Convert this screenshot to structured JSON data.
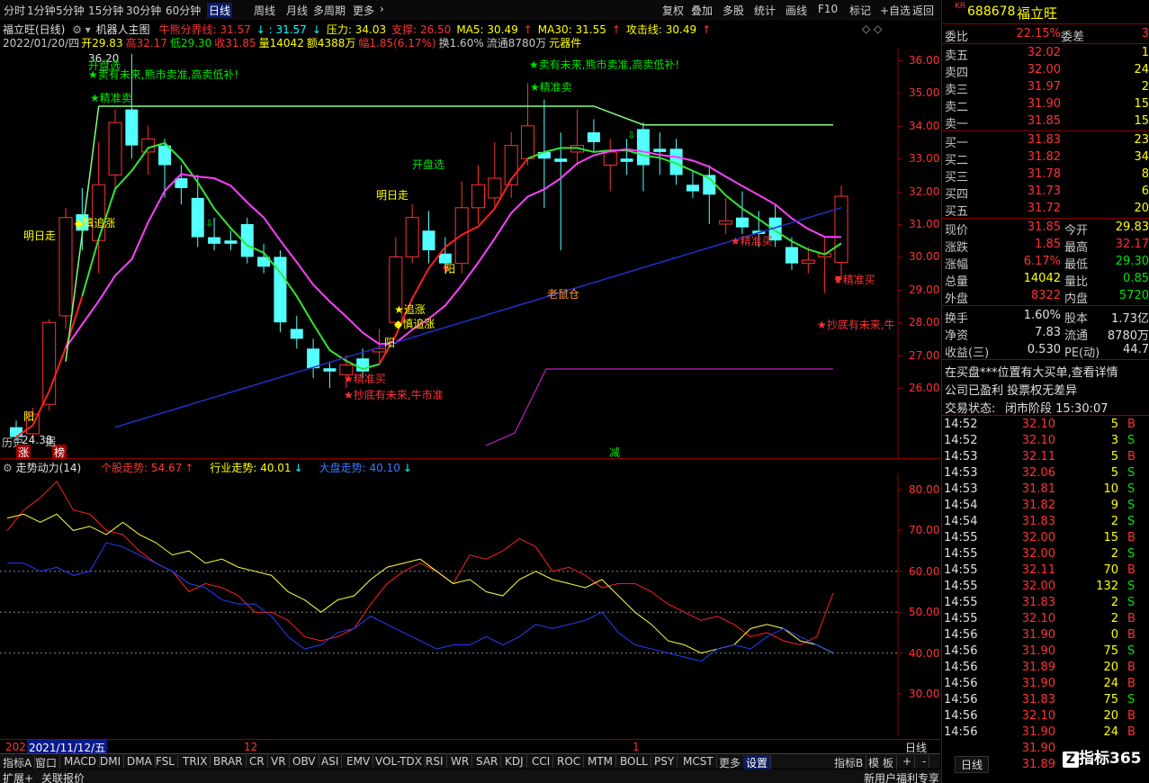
{
  "toolbar": {
    "left": [
      "分时",
      "1分钟",
      "5分钟",
      "15分钟",
      "30分钟",
      "60分钟",
      "日线",
      "周线",
      "月线",
      "多周期",
      "更多"
    ],
    "active": "日线",
    "right": [
      "复权",
      "叠加",
      "多股",
      "统计",
      "画线",
      "F10",
      "标记",
      "+自选",
      "返回"
    ]
  },
  "header": {
    "title": "福立旺(日线)",
    "indicator": "机器人主图",
    "ind_items": [
      {
        "t": "牛熊分界线: 31.57",
        "c": "#ff3232"
      },
      {
        "t": "↓ : 31.57",
        "c": "#00ffff"
      },
      {
        "t": "↓",
        "c": "#00ffff"
      },
      {
        "t": "压力: 34.03",
        "c": "#ffff00"
      },
      {
        "t": "支撑: 26.50",
        "c": "#ff3232"
      },
      {
        "t": "MA5: 30.49",
        "c": "#ffff00"
      },
      {
        "t": "↑",
        "c": "#ff3232"
      },
      {
        "t": "MA30: 31.55",
        "c": "#ffff00"
      },
      {
        "t": "↑",
        "c": "#ff3232"
      },
      {
        "t": "攻击线: 30.49",
        "c": "#ffff00"
      },
      {
        "t": "↑",
        "c": "#ff3232"
      }
    ],
    "quote": [
      {
        "t": "2022/01/20/四",
        "c": "#c8c8c8"
      },
      {
        "t": "开29.83",
        "c": "#ffff00"
      },
      {
        "t": "高32.17",
        "c": "#ff3232"
      },
      {
        "t": "低29.30",
        "c": "#00e600"
      },
      {
        "t": "收31.85",
        "c": "#ff3232"
      },
      {
        "t": "量14042",
        "c": "#ffff00"
      },
      {
        "t": "额4388万",
        "c": "#ffff00"
      },
      {
        "t": "幅1.85(6.17%)",
        "c": "#ff3232"
      },
      {
        "t": "换1.60%",
        "c": "#c8c8c8"
      },
      {
        "t": "流通8780万",
        "c": "#c8c8c8"
      },
      {
        "t": "元器件",
        "c": "#ffff00"
      }
    ]
  },
  "price_axis": [
    "36.00",
    "35.00",
    "34.00",
    "33.00",
    "32.00",
    "31.00",
    "30.00",
    "29.00",
    "28.00",
    "27.00",
    "26.00"
  ],
  "high_label": "36.20",
  "low_label": "24.38",
  "low_prefix": "历史",
  "annotations": [
    {
      "t": "开盘选",
      "c": "#00e600"
    },
    {
      "t": "★卖有未来,熊市卖准,高卖低补!",
      "c": "#00e600"
    },
    {
      "t": "★精准卖",
      "c": "#00e600"
    },
    {
      "t": "★卖有未来,熊市卖准,高卖低补!",
      "c": "#00e600"
    },
    {
      "t": "★精准卖",
      "c": "#00e600"
    },
    {
      "t": "开盘选",
      "c": "#00e600"
    },
    {
      "t": "明日走",
      "c": "#ffff00"
    },
    {
      "t": "明日走",
      "c": "#ffff00"
    },
    {
      "t": "◆慎追涨",
      "c": "#ffff00"
    },
    {
      "t": "★追涨",
      "c": "#ffff00"
    },
    {
      "t": "◆慎追涨",
      "c": "#ffff00"
    },
    {
      "t": "阳",
      "c": "#ffff00"
    },
    {
      "t": "阳",
      "c": "#ffff00"
    },
    {
      "t": "阳",
      "c": "#ffff00"
    },
    {
      "t": "★精准买",
      "c": "#ff3232"
    },
    {
      "t": "★抄底有未来,牛市准",
      "c": "#ff3232"
    },
    {
      "t": "老鼠仓",
      "c": "#ff9933"
    },
    {
      "t": "★精准买",
      "c": "#ff3232"
    },
    {
      "t": "★精准买",
      "c": "#ff3232"
    },
    {
      "t": "★抄底有未来,牛",
      "c": "#ff3232"
    },
    {
      "t": "减",
      "c": "#00e600"
    },
    {
      "t": "涨",
      "c": "#fff"
    },
    {
      "t": "榜",
      "c": "#fff"
    },
    {
      "t": "据",
      "c": "#c8c8c8"
    }
  ],
  "sub": {
    "title": "走势动力(14)",
    "items": [
      {
        "t": "个股走势: 54.67",
        "c": "#ff3232"
      },
      {
        "t": "↑",
        "c": "#ff3232"
      },
      {
        "t": "行业走势: 40.01",
        "c": "#ffff00"
      },
      {
        "t": "↓",
        "c": "#00ffff"
      },
      {
        "t": "大盘走势: 40.10",
        "c": "#3c78ff"
      },
      {
        "t": "↓",
        "c": "#00ffff"
      }
    ],
    "axis": [
      "80.00",
      "70.00",
      "60.00",
      "50.00",
      "40.00",
      "30.00"
    ]
  },
  "date_axis": {
    "prefix": "202",
    "date": "2021/11/12/五",
    "m12": "12",
    "m1": "1"
  },
  "bottom_tabs": [
    "指标A",
    "窗口",
    "MACD",
    "DMI",
    "DMA",
    "FSL",
    "TRIX",
    "BRAR",
    "CR",
    "VR",
    "OBV",
    "ASI",
    "EMV",
    "VOL-TDX",
    "RSI",
    "WR",
    "SAR",
    "KDJ",
    "CCI",
    "ROC",
    "MTM",
    "BOLL",
    "PSY",
    "MCST",
    "更多",
    "设置"
  ],
  "bottom_right": [
    "指标B",
    "模 板",
    "+",
    "-",
    "日线"
  ],
  "status": {
    "left1": "扩展+",
    "left2": "关联报价",
    "right": "新用户福利专享",
    "right2": "笔"
  },
  "stock": {
    "code": "688678",
    "name": "福立旺",
    "kr": "KR"
  },
  "orderbook": {
    "weibi_label": "委比",
    "weibi": "22.15%",
    "weicha_label": "委差",
    "weicha": "3",
    "sells": [
      {
        "l": "卖五",
        "p": "32.02",
        "v": "1"
      },
      {
        "l": "卖四",
        "p": "32.00",
        "v": "24"
      },
      {
        "l": "卖三",
        "p": "31.97",
        "v": "2"
      },
      {
        "l": "卖二",
        "p": "31.90",
        "v": "15"
      },
      {
        "l": "卖一",
        "p": "31.85",
        "v": "15"
      }
    ],
    "buys": [
      {
        "l": "买一",
        "p": "31.83",
        "v": "23"
      },
      {
        "l": "买二",
        "p": "31.82",
        "v": "34"
      },
      {
        "l": "买三",
        "p": "31.78",
        "v": "8"
      },
      {
        "l": "买四",
        "p": "31.73",
        "v": "6"
      },
      {
        "l": "买五",
        "p": "31.72",
        "v": "20"
      }
    ]
  },
  "stats": [
    {
      "l1": "现价",
      "v1": "31.85",
      "c1": "#ff3232",
      "l2": "今开",
      "v2": "29.83",
      "c2": "#ffff00"
    },
    {
      "l1": "涨跌",
      "v1": "1.85",
      "c1": "#ff3232",
      "l2": "最高",
      "v2": "32.17",
      "c2": "#ff3232"
    },
    {
      "l1": "涨幅",
      "v1": "6.17%",
      "c1": "#ff3232",
      "l2": "最低",
      "v2": "29.30",
      "c2": "#00e600"
    },
    {
      "l1": "总量",
      "v1": "14042",
      "c1": "#ffff00",
      "l2": "量比",
      "v2": "0.85",
      "c2": "#00e600"
    },
    {
      "l1": "外盘",
      "v1": "8322",
      "c1": "#ff3232",
      "l2": "内盘",
      "v2": "5720",
      "c2": "#00e600"
    },
    {
      "l1": "换手",
      "v1": "1.60%",
      "c1": "#e0e0e0",
      "l2": "股本",
      "v2": "1.73亿",
      "c2": "#e0e0e0"
    },
    {
      "l1": "净资",
      "v1": "7.83",
      "c1": "#e0e0e0",
      "l2": "流通",
      "v2": "8780万",
      "c2": "#e0e0e0"
    },
    {
      "l1": "收益(三)",
      "v1": "0.530",
      "c1": "#e0e0e0",
      "l2": "PE(动)",
      "v2": "44.7",
      "c2": "#e0e0e0"
    }
  ],
  "notices": [
    "在买盘***位置有大买单,查看详情",
    "公司已盈利 投票权无差异"
  ],
  "trade_status": {
    "label": "交易状态:",
    "value": "闭市阶段 15:30:07"
  },
  "ticks": [
    {
      "t": "14:52",
      "p": "32.10",
      "v": "5",
      "s": "B"
    },
    {
      "t": "14:52",
      "p": "32.10",
      "v": "3",
      "s": "S"
    },
    {
      "t": "14:53",
      "p": "32.11",
      "v": "5",
      "s": "B"
    },
    {
      "t": "14:53",
      "p": "32.06",
      "v": "5",
      "s": "S"
    },
    {
      "t": "14:53",
      "p": "31.81",
      "v": "10",
      "s": "S"
    },
    {
      "t": "14:54",
      "p": "31.82",
      "v": "9",
      "s": "S"
    },
    {
      "t": "14:54",
      "p": "31.83",
      "v": "2",
      "s": "S"
    },
    {
      "t": "14:55",
      "p": "32.00",
      "v": "15",
      "s": "B"
    },
    {
      "t": "14:55",
      "p": "32.00",
      "v": "2",
      "s": "S"
    },
    {
      "t": "14:55",
      "p": "32.11",
      "v": "70",
      "s": "B"
    },
    {
      "t": "14:55",
      "p": "32.00",
      "v": "132",
      "s": "S"
    },
    {
      "t": "14:55",
      "p": "31.83",
      "v": "2",
      "s": "S"
    },
    {
      "t": "14:55",
      "p": "32.10",
      "v": "2",
      "s": "B"
    },
    {
      "t": "14:56",
      "p": "31.90",
      "v": "0",
      "s": "B"
    },
    {
      "t": "14:56",
      "p": "31.90",
      "v": "75",
      "s": "S"
    },
    {
      "t": "14:56",
      "p": "31.89",
      "v": "20",
      "s": "B"
    },
    {
      "t": "14:56",
      "p": "31.90",
      "v": "24",
      "s": "B"
    },
    {
      "t": "14:56",
      "p": "31.83",
      "v": "75",
      "s": "S"
    },
    {
      "t": "14:56",
      "p": "32.10",
      "v": "20",
      "s": "B"
    },
    {
      "t": "14:56",
      "p": "31.90",
      "v": "24",
      "s": "B"
    },
    {
      "t": "",
      "p": "31.90",
      "v": "",
      "s": ""
    },
    {
      "t": "",
      "p": "31.89",
      "v": "",
      "s": ""
    }
  ],
  "right_bottom_tab": "日线",
  "watermark": "指标365",
  "chart_data": {
    "type": "candlestick",
    "ylim": [
      25.0,
      36.5
    ],
    "candles": [
      [
        24.8,
        24.5,
        25.0,
        24.38
      ],
      [
        24.6,
        25.2,
        25.4,
        24.4
      ],
      [
        25.5,
        28.0,
        28.1,
        25.3
      ],
      [
        28.2,
        31.2,
        31.5,
        27.8
      ],
      [
        31.3,
        30.8,
        32.1,
        30.2
      ],
      [
        30.5,
        32.2,
        33.5,
        29.5
      ],
      [
        32.5,
        34.1,
        34.5,
        32.0
      ],
      [
        34.5,
        33.4,
        36.2,
        33.0
      ],
      [
        33.2,
        33.6,
        34.0,
        32.5
      ],
      [
        33.4,
        32.8,
        33.6,
        31.8
      ],
      [
        32.4,
        32.1,
        32.8,
        31.6
      ],
      [
        31.8,
        30.6,
        32.5,
        30.3
      ],
      [
        30.6,
        30.4,
        31.2,
        30.2
      ],
      [
        30.5,
        30.4,
        30.8,
        30.2
      ],
      [
        31.0,
        30.0,
        31.2,
        29.8
      ],
      [
        30.0,
        29.7,
        30.4,
        29.5
      ],
      [
        30.0,
        28.0,
        30.2,
        27.7
      ],
      [
        27.8,
        27.5,
        28.2,
        27.2
      ],
      [
        27.2,
        26.6,
        27.5,
        26.3
      ],
      [
        26.6,
        26.5,
        26.8,
        26.0
      ],
      [
        26.4,
        26.7,
        27.0,
        26.0
      ],
      [
        26.9,
        26.5,
        27.2,
        26.3
      ],
      [
        27.1,
        27.2,
        27.8,
        26.8
      ],
      [
        28.0,
        30.0,
        30.6,
        27.8
      ],
      [
        30.0,
        31.2,
        31.6,
        29.8
      ],
      [
        30.8,
        30.2,
        31.4,
        29.8
      ],
      [
        30.1,
        29.8,
        30.6,
        29.5
      ],
      [
        29.8,
        31.5,
        32.3,
        29.5
      ],
      [
        31.5,
        32.2,
        32.8,
        31.0
      ],
      [
        31.8,
        32.4,
        33.5,
        31.5
      ],
      [
        32.2,
        33.4,
        33.8,
        31.8
      ],
      [
        33.0,
        34.0,
        35.3,
        32.8
      ],
      [
        33.2,
        33.0,
        34.8,
        31.5
      ],
      [
        33.0,
        32.9,
        33.8,
        30.2
      ],
      [
        33.2,
        33.4,
        34.5,
        32.8
      ],
      [
        33.8,
        33.5,
        34.2,
        33.2
      ],
      [
        32.8,
        33.2,
        33.6,
        32.0
      ],
      [
        33.0,
        32.9,
        33.6,
        32.5
      ],
      [
        33.9,
        32.8,
        34.1,
        32.0
      ],
      [
        33.3,
        33.2,
        33.8,
        32.5
      ],
      [
        33.3,
        32.5,
        33.6,
        32.2
      ],
      [
        32.2,
        32.0,
        32.6,
        31.8
      ],
      [
        32.5,
        31.9,
        32.8,
        31.0
      ],
      [
        31.0,
        31.1,
        31.8,
        30.7
      ],
      [
        31.2,
        30.9,
        32.0,
        30.7
      ],
      [
        30.8,
        30.7,
        31.4,
        30.3
      ],
      [
        31.2,
        30.5,
        31.6,
        30.3
      ],
      [
        30.3,
        29.8,
        30.6,
        29.6
      ],
      [
        29.8,
        29.9,
        30.3,
        29.5
      ],
      [
        30.0,
        30.1,
        30.6,
        28.9
      ],
      [
        29.83,
        31.85,
        32.17,
        29.3
      ]
    ],
    "series": [
      {
        "name": "个股走势",
        "values": [
          70,
          75,
          78,
          82,
          75,
          74,
          70,
          69,
          65,
          62,
          60,
          55,
          57,
          56,
          54,
          50,
          50,
          48,
          44,
          43,
          44,
          46,
          52,
          57,
          60,
          62,
          60,
          57,
          64,
          63,
          65,
          68,
          66,
          60,
          61,
          59,
          56,
          57,
          57,
          55,
          52,
          50,
          48,
          49,
          47,
          44,
          45,
          43,
          42,
          44,
          54.67
        ]
      },
      {
        "name": "行业走势",
        "values": [
          73,
          74,
          72,
          74,
          70,
          71,
          69,
          72,
          69,
          67,
          64,
          65,
          62,
          63,
          61,
          60,
          59,
          55,
          53,
          50,
          53,
          54,
          58,
          61,
          62,
          63,
          60,
          57,
          58,
          55,
          54,
          58,
          60,
          58,
          57,
          56,
          58,
          54,
          50,
          47,
          43,
          42,
          40,
          41,
          42,
          46,
          47,
          46,
          43,
          42,
          40.01
        ]
      },
      {
        "name": "大盘走势",
        "values": [
          62,
          62,
          60,
          61,
          59,
          60,
          67,
          66,
          64,
          62,
          60,
          57,
          56,
          53,
          52,
          52,
          49,
          44,
          41,
          42,
          45,
          46,
          49,
          47,
          45,
          43,
          41,
          42,
          42,
          44,
          42,
          44,
          47,
          46,
          47,
          48,
          50,
          45,
          42,
          41,
          40,
          39,
          38,
          41,
          42,
          41,
          44,
          46,
          44,
          42,
          40.1
        ]
      }
    ],
    "sub_ylim": [
      20,
      85
    ]
  }
}
